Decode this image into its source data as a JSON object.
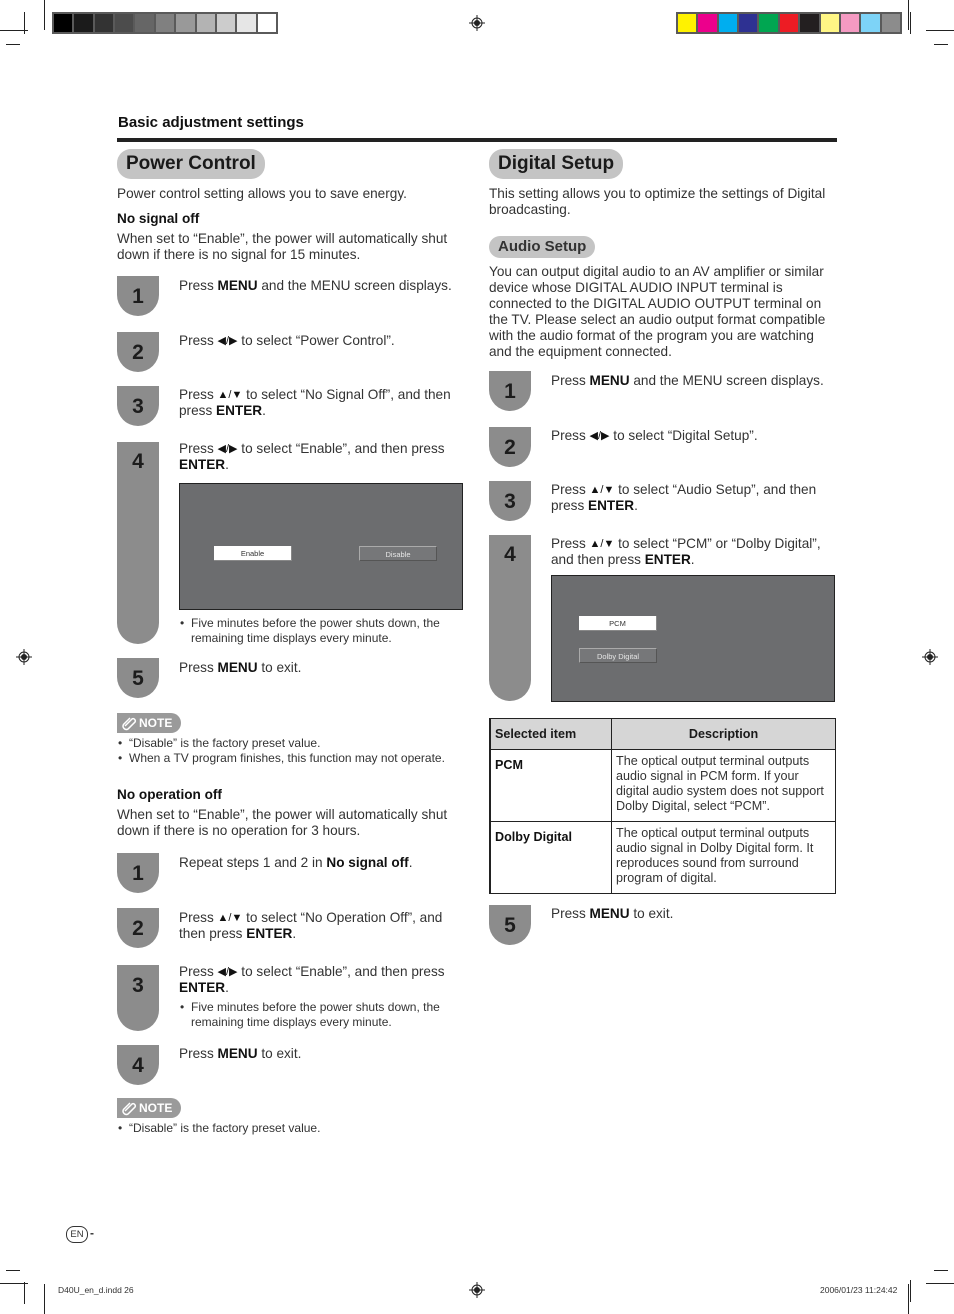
{
  "print_marks": {
    "grayscale_swatches": [
      "#000000",
      "#1b1b1b",
      "#333333",
      "#4c4c4c",
      "#666666",
      "#808080",
      "#999999",
      "#b3b3b3",
      "#cccccc",
      "#e6e6e6",
      "#ffffff"
    ],
    "color_swatches": [
      "#fff200",
      "#ec008c",
      "#00aeef",
      "#2e3192",
      "#00a651",
      "#ed1c24",
      "#231f20",
      "#fff685",
      "#f49ac2",
      "#7dd3f7",
      "#8c8c8c"
    ],
    "footer_file": "D40U_en_d.indd   26",
    "footer_timestamp": "2006/01/23   11:24:42"
  },
  "header": {
    "section": "Basic adjustment settings"
  },
  "power_control": {
    "title": "Power Control",
    "intro": "Power control setting allows you to save energy.",
    "no_signal": {
      "heading": "No signal off",
      "description": "When set to “Enable”, the power will automatically shut down if there is no signal for 15 minutes.",
      "steps": [
        {
          "num": "1",
          "pre": "Press ",
          "key": "MENU",
          "post": " and the MENU screen displays."
        },
        {
          "num": "2",
          "pre": "Press ",
          "arrows": "◀/▶",
          "post": " to select “Power Control”."
        },
        {
          "num": "3",
          "pre": "Press ",
          "arrows": "▲/▼",
          "post": " to select “No Signal Off”, and then press ",
          "key": "ENTER",
          "end": "."
        },
        {
          "num": "4",
          "pre": "Press ",
          "arrows": "◀/▶",
          "post": " to select “Enable”, and then press ",
          "key": "ENTER",
          "end": "."
        },
        {
          "num": "5",
          "pre": "Press ",
          "key": "MENU",
          "post": " to exit."
        }
      ],
      "screen": {
        "options": [
          "Enable",
          "Disable"
        ],
        "selected": "Enable"
      },
      "step4_bullet": "Five minutes before the power shuts down, the remaining time displays every minute.",
      "note_label": "NOTE",
      "notes": [
        "“Disable” is the factory preset value.",
        "When a TV program finishes, this function may not operate."
      ]
    },
    "no_operation": {
      "heading": "No operation off",
      "description": "When set to “Enable”, the power will automatically shut down if there is no operation for 3 hours.",
      "steps": [
        {
          "num": "1",
          "pre": "Repeat steps 1 and 2 in ",
          "key": "No signal off",
          "end": "."
        },
        {
          "num": "2",
          "pre": "Press ",
          "arrows": "▲/▼",
          "post": " to select “No Operation Off”, and then press ",
          "key": "ENTER",
          "end": "."
        },
        {
          "num": "3",
          "pre": "Press ",
          "arrows": "◀/▶",
          "post": " to select “Enable”, and then press ",
          "key": "ENTER",
          "end": "."
        },
        {
          "num": "4",
          "pre": "Press ",
          "key": "MENU",
          "post": " to exit."
        }
      ],
      "step3_bullet": "Five minutes before the power shuts down, the remaining time displays every minute.",
      "note_label": "NOTE",
      "notes": [
        "“Disable” is the factory preset value."
      ]
    }
  },
  "digital_setup": {
    "title": "Digital Setup",
    "intro": "This setting allows you to optimize the settings of Digital broadcasting.",
    "audio_setup": {
      "title": "Audio Setup",
      "description": "You can output digital audio to an AV amplifier or similar device whose DIGITAL AUDIO INPUT terminal is connected to the DIGITAL AUDIO OUTPUT terminal on the TV. Please select an audio output format compatible with the audio format of the program you are watching and the equipment connected.",
      "steps": [
        {
          "num": "1",
          "pre": "Press ",
          "key": "MENU",
          "post": " and the MENU screen displays."
        },
        {
          "num": "2",
          "pre": "Press ",
          "arrows": "◀/▶",
          "post": " to select “Digital Setup”."
        },
        {
          "num": "3",
          "pre": "Press ",
          "arrows": "▲/▼",
          "post": " to select “Audio Setup”, and then press ",
          "key": "ENTER",
          "end": "."
        },
        {
          "num": "4",
          "pre": "Press ",
          "arrows": "▲/▼",
          "post": " to select “PCM” or “Dolby Digital”, and then press ",
          "key": "ENTER",
          "end": "."
        },
        {
          "num": "5",
          "pre": "Press ",
          "key": "MENU",
          "post": " to exit."
        }
      ],
      "screen": {
        "options": [
          "PCM",
          "Dolby Digital"
        ],
        "selected": "PCM"
      },
      "table": {
        "headers": [
          "Selected item",
          "Description"
        ],
        "rows": [
          {
            "item": "PCM",
            "description": "The optical output terminal outputs audio signal in PCM form. If your digital audio system does not support Dolby Digital, select “PCM”."
          },
          {
            "item": "Dolby Digital",
            "description": "The optical output terminal outputs audio signal in Dolby Digital form. It reproduces sound from surround program of digital."
          }
        ]
      }
    }
  },
  "page_footer": {
    "language_badge": "EN",
    "page_suffix": "-"
  }
}
